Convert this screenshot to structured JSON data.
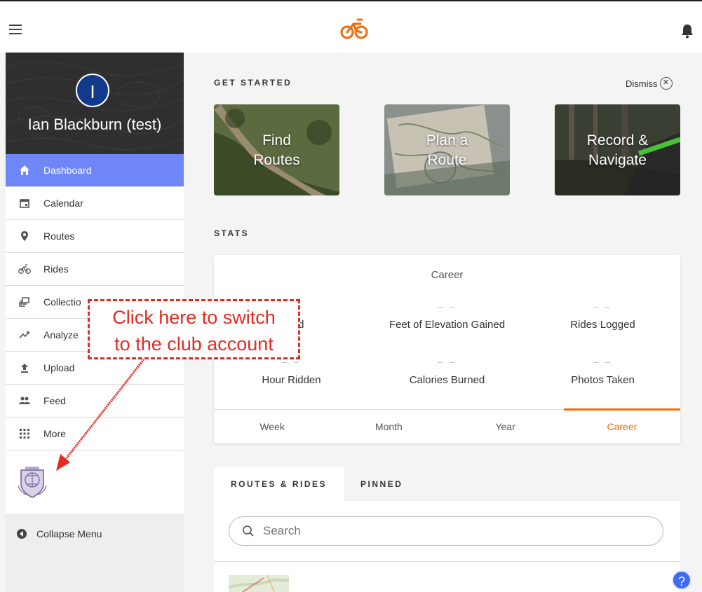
{
  "header": {
    "menu_icon": "hamburger-icon",
    "logo_icon": "bicycle-logo-icon",
    "notification_icon": "bell-icon",
    "brand_color": "#f06a0a"
  },
  "profile": {
    "initial": "I",
    "name": "Ian Blackburn (test)"
  },
  "sidebar": {
    "items": [
      {
        "label": "Dashboard",
        "icon": "home-icon",
        "active": true
      },
      {
        "label": "Calendar",
        "icon": "calendar-icon"
      },
      {
        "label": "Routes",
        "icon": "map-pin-icon"
      },
      {
        "label": "Rides",
        "icon": "bike-icon"
      },
      {
        "label": "Collectio",
        "icon": "collections-icon"
      },
      {
        "label": "Analyze",
        "icon": "trend-icon"
      },
      {
        "label": "Upload",
        "icon": "upload-icon"
      },
      {
        "label": "Feed",
        "icon": "people-icon"
      },
      {
        "label": "More",
        "icon": "grid-icon"
      }
    ],
    "active_color": "#6f86f8",
    "collapse_label": "Collapse Menu"
  },
  "get_started": {
    "title": "GET STARTED",
    "dismiss_label": "Dismiss",
    "cards": [
      {
        "line1": "Find",
        "line2": "Routes"
      },
      {
        "line1": "Plan a",
        "line2": "Route"
      },
      {
        "line1": "Record &",
        "line2": "Navigate"
      }
    ]
  },
  "stats": {
    "title": "STATS",
    "period": "Career",
    "items": [
      {
        "value": "– –",
        "label": "veled"
      },
      {
        "value": "– –",
        "label": "Feet of Elevation Gained"
      },
      {
        "value": "– –",
        "label": "Rides Logged"
      },
      {
        "value": "– –",
        "label": "Hour Ridden"
      },
      {
        "value": "– –",
        "label": "Calories Burned"
      },
      {
        "value": "– –",
        "label": "Photos Taken"
      }
    ],
    "tabs": [
      "Week",
      "Month",
      "Year",
      "Career"
    ],
    "active_tab": "Career"
  },
  "routes_rides": {
    "tabs": [
      "ROUTES & RIDES",
      "PINNED"
    ],
    "search_placeholder": "Search"
  },
  "annotation": {
    "line1": "Click here to switch",
    "line2": "to the club account",
    "color": "#e52a20"
  },
  "help_icon": "help-icon"
}
